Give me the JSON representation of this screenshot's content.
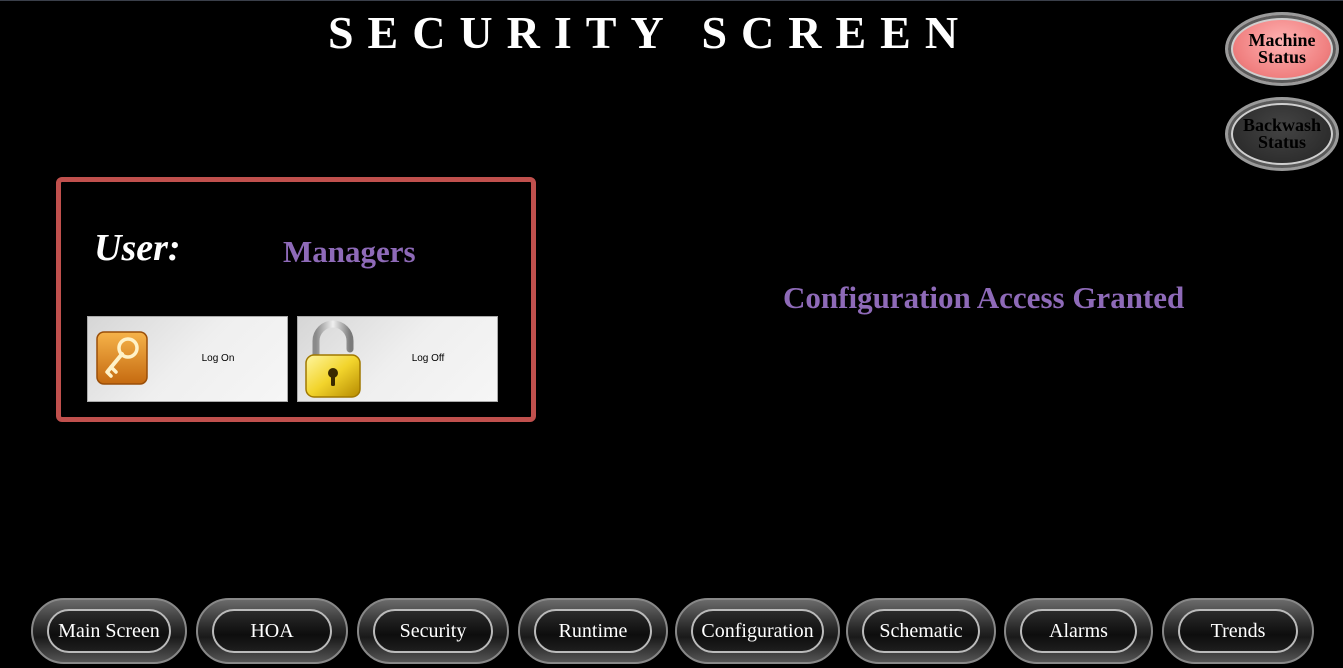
{
  "header": {
    "title": "SECURITY  SCREEN"
  },
  "status_buttons": {
    "machine": "Machine\nStatus",
    "backwash": "Backwash\nStatus",
    "machine_color": "#f08080",
    "backwash_color": "#2b2b2b"
  },
  "login_panel": {
    "user_label": "User:",
    "user_value": "Managers",
    "logon_label": "Log On",
    "logoff_label": "Log Off",
    "border_color": "#c0504d",
    "logon_icon": "key-icon",
    "logoff_icon": "padlock-icon"
  },
  "access_message": "Configuration Access Granted",
  "accent_color": "#8e6ab8",
  "nav": [
    "Main Screen",
    "HOA",
    "Security",
    "Runtime",
    "Configuration",
    "Schematic",
    "Alarms",
    "Trends"
  ]
}
